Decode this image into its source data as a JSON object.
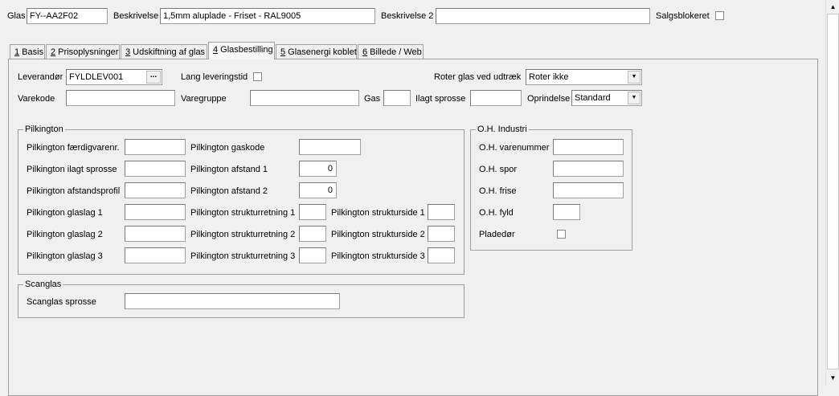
{
  "header": {
    "glas_label": "Glas",
    "glas_value": "FY--AA2F02",
    "beskrivelse_label": "Beskrivelse",
    "beskrivelse_value": "1,5mm aluplade - Friset - RAL9005",
    "beskrivelse2_label": "Beskrivelse 2",
    "beskrivelse2_value": "",
    "salgsblokeret_label": "Salgsblokeret",
    "salgsblokeret_checked": false
  },
  "tabs": [
    {
      "key": "1",
      "label": " Basis"
    },
    {
      "key": "2",
      "label": " Prisoplysninger"
    },
    {
      "key": "3",
      "label": " Udskiftning af glas"
    },
    {
      "key": "4",
      "label": " Glasbestilling"
    },
    {
      "key": "5",
      "label": " Glasenergi koblet"
    },
    {
      "key": "6",
      "label": " Billede / Web"
    }
  ],
  "active_tab": "4",
  "form": {
    "leverandor_label": "Leverandør",
    "leverandor_value": "FYLDLEV001",
    "lang_leveringstid_label": "Lang leveringstid",
    "roter_label": "Roter glas ved udtræk",
    "roter_value": "Roter ikke",
    "varekode_label": "Varekode",
    "varekode_value": "",
    "varegruppe_label": "Varegruppe",
    "varegruppe_value": "",
    "gas_label": "Gas",
    "gas_value": "",
    "ilagt_sprosse_label": "Ilagt sprosse",
    "ilagt_sprosse_value": "",
    "oprindelse_label": "Oprindelse",
    "oprindelse_value": "Standard"
  },
  "pilkington": {
    "title": "Pilkington",
    "faerdigvarenr_label": "Pilkington færdigvarenr.",
    "ilagt_sprosse_label": "Pilkington ilagt sprosse",
    "afstandsprofil_label": "Pilkington afstandsprofil",
    "glaslag1_label": "Pilkington glaslag 1",
    "glaslag2_label": "Pilkington glaslag 2",
    "glaslag3_label": "Pilkington glaslag 3",
    "gaskode_label": "Pilkington gaskode",
    "afstand1_label": "Pilkington afstand 1",
    "afstand1_value": "0",
    "afstand2_label": "Pilkington afstand 2",
    "afstand2_value": "0",
    "strukturretning1_label": "Pilkington strukturretning 1",
    "strukturretning2_label": "Pilkington strukturretning 2",
    "strukturretning3_label": "Pilkington strukturretning 3",
    "strukturside1_label": "Pilkington strukturside 1",
    "strukturside2_label": "Pilkington strukturside 2",
    "strukturside3_label": "Pilkington strukturside 3"
  },
  "oh_industri": {
    "title": "O.H. Industri",
    "varenummer_label": "O.H. varenummer",
    "spor_label": "O.H. spor",
    "frise_label": "O.H. frise",
    "fyld_label": "O.H. fyld",
    "pladedor_label": "Pladedør"
  },
  "scanglas": {
    "title": "Scanglas",
    "sprosse_label": "Scanglas sprosse"
  },
  "icons": {
    "dropdown": "chevron-down-icon",
    "browse": "ellipsis-icon",
    "scroll_up": "arrow-up-icon",
    "scroll_down": "arrow-down-icon"
  }
}
